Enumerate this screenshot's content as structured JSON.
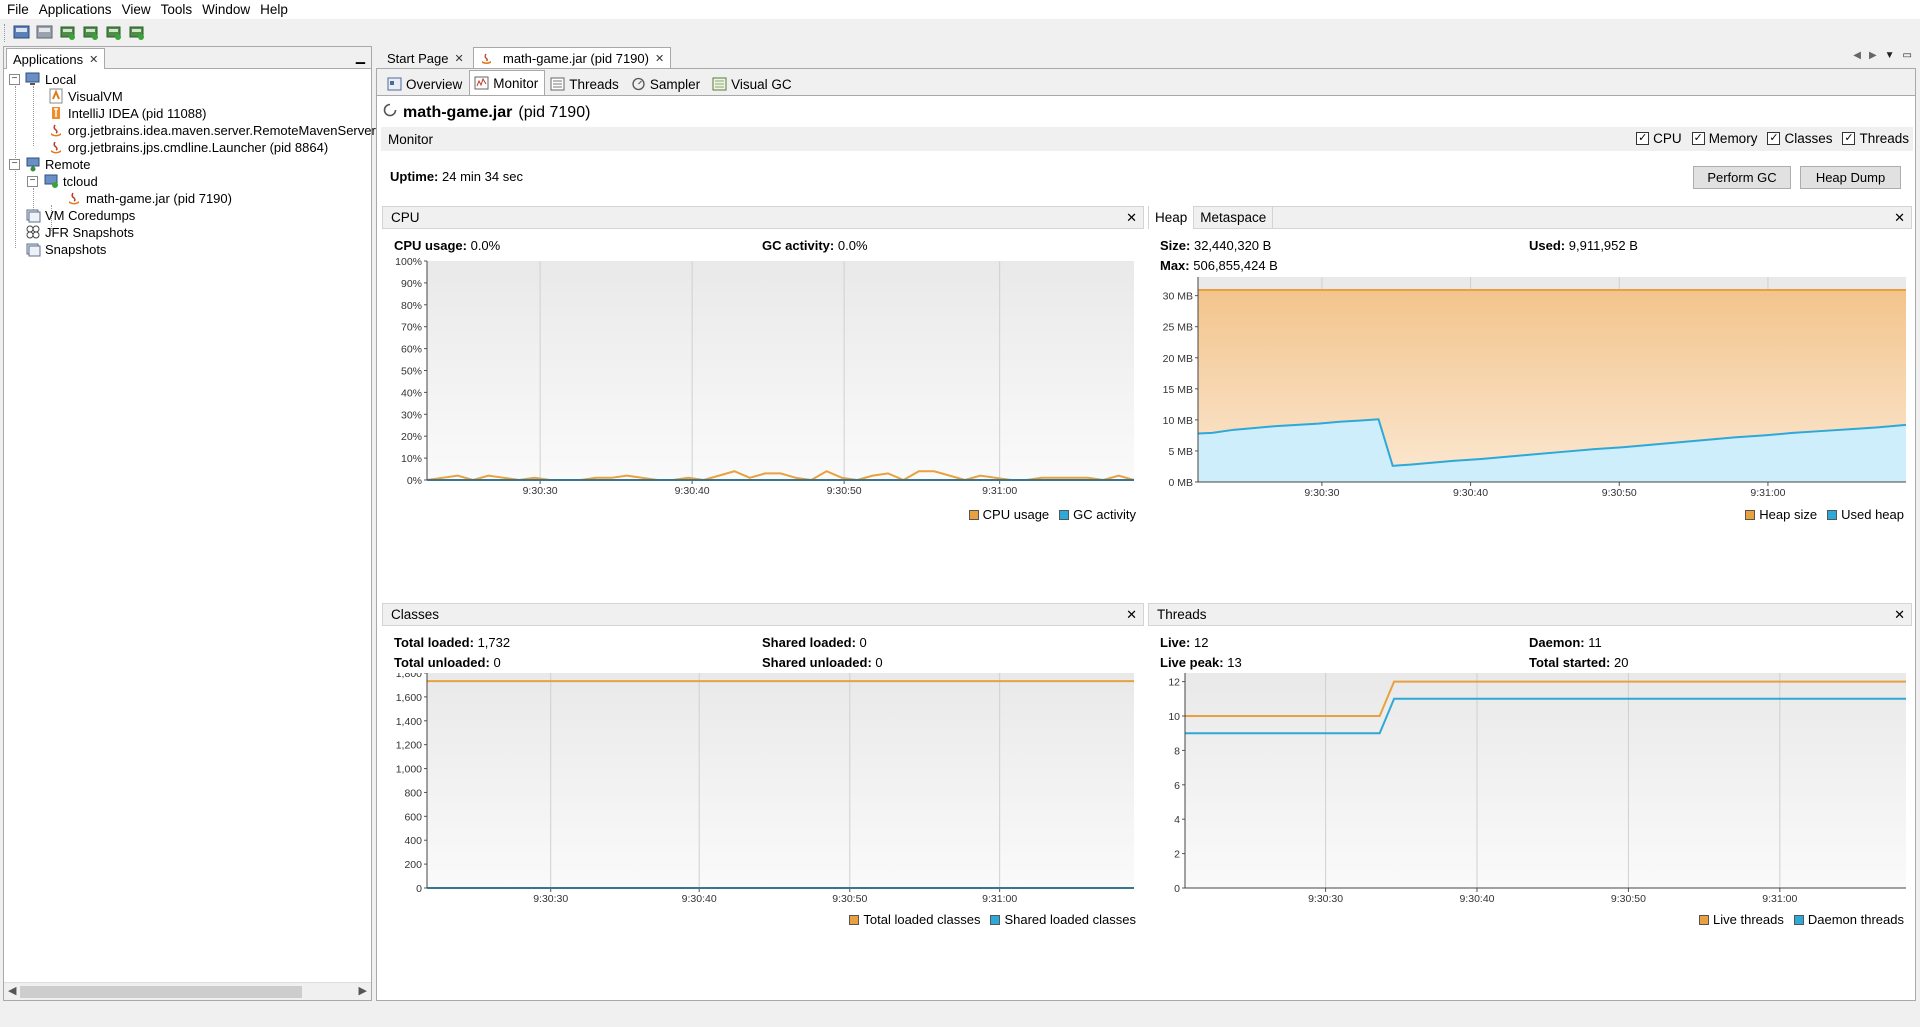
{
  "menu": [
    "File",
    "Applications",
    "View",
    "Tools",
    "Window",
    "Help"
  ],
  "toolbar_icons": [
    "load-application-dump-icon",
    "load-snapshot-icon",
    "add-remote-host-icon",
    "add-jmx-connection-icon",
    "add-coredump-icon",
    "add-heap-dump-icon"
  ],
  "left_panel": {
    "tab_label": "Applications",
    "tree": [
      {
        "label": "Local",
        "icon": "computer-icon",
        "level": 0,
        "toggle": "-"
      },
      {
        "label": "VisualVM",
        "icon": "visualvm-icon",
        "level": 1
      },
      {
        "label": "IntelliJ IDEA (pid 11088)",
        "icon": "intellij-icon",
        "level": 1
      },
      {
        "label": "org.jetbrains.idea.maven.server.RemoteMavenServer",
        "icon": "java-icon",
        "level": 1
      },
      {
        "label": "org.jetbrains.jps.cmdline.Launcher (pid 8864)",
        "icon": "java-icon",
        "level": 1
      },
      {
        "label": "Remote",
        "icon": "network-icon",
        "level": 0,
        "toggle": "-"
      },
      {
        "label": "tcloud",
        "icon": "host-icon",
        "level": 1,
        "toggle": "-"
      },
      {
        "label": "math-game.jar (pid 7190)",
        "icon": "java-icon",
        "level": 2
      },
      {
        "label": "VM Coredumps",
        "icon": "coredumps-icon",
        "level": 0
      },
      {
        "label": "JFR Snapshots",
        "icon": "jfr-icon",
        "level": 0
      },
      {
        "label": "Snapshots",
        "icon": "snapshots-icon",
        "level": 0
      }
    ]
  },
  "doc_tabs": [
    {
      "label": "Start Page",
      "active": false
    },
    {
      "label": "math-game.jar (pid 7190)",
      "active": true
    }
  ],
  "view_tabs": [
    {
      "label": "Overview",
      "icon": "overview-icon"
    },
    {
      "label": "Monitor",
      "icon": "monitor-icon",
      "active": true
    },
    {
      "label": "Threads",
      "icon": "threads-icon"
    },
    {
      "label": "Sampler",
      "icon": "sampler-icon"
    },
    {
      "label": "Visual GC",
      "icon": "visual-gc-icon"
    }
  ],
  "app_title": {
    "name": "math-game.jar",
    "pid": "(pid 7190)"
  },
  "monitor": {
    "label": "Monitor",
    "checks": [
      {
        "label": "CPU",
        "checked": true
      },
      {
        "label": "Memory",
        "checked": true
      },
      {
        "label": "Classes",
        "checked": true
      },
      {
        "label": "Threads",
        "checked": true
      }
    ],
    "uptime_label": "Uptime:",
    "uptime_value": "24 min 34 sec",
    "perform_gc": "Perform GC",
    "heap_dump": "Heap Dump"
  },
  "colors": {
    "orange": "#e8a13e",
    "blue": "#2ea8d8",
    "heap_fill_top": "#f3c48c",
    "heap_fill_bottom": "#fbe8d2",
    "used_fill": "#cdeefa",
    "plot_bg_top": "#e9e9e9",
    "plot_bg_bottom": "#fafafa"
  },
  "cpu_panel": {
    "title": "CPU",
    "cpu_usage_label": "CPU usage:",
    "cpu_usage_value": "0.0%",
    "gc_label": "GC activity:",
    "gc_value": "0.0%",
    "legend": [
      "CPU usage",
      "GC activity"
    ]
  },
  "heap_panel": {
    "tabs": [
      "Heap",
      "Metaspace"
    ],
    "size_label": "Size:",
    "size_value": "32,440,320 B",
    "used_label": "Used:",
    "used_value": "9,911,952 B",
    "max_label": "Max:",
    "max_value": "506,855,424 B",
    "legend": [
      "Heap size",
      "Used heap"
    ]
  },
  "classes_panel": {
    "title": "Classes",
    "total_loaded_label": "Total loaded:",
    "total_loaded_value": "1,732",
    "shared_loaded_label": "Shared loaded:",
    "shared_loaded_value": "0",
    "total_unloaded_label": "Total unloaded:",
    "total_unloaded_value": "0",
    "shared_unloaded_label": "Shared unloaded:",
    "shared_unloaded_value": "0",
    "legend": [
      "Total loaded classes",
      "Shared loaded classes"
    ]
  },
  "threads_panel": {
    "title": "Threads",
    "live_label": "Live:",
    "live_value": "12",
    "daemon_label": "Daemon:",
    "daemon_value": "11",
    "peak_label": "Live peak:",
    "peak_value": "13",
    "started_label": "Total started:",
    "started_value": "20",
    "legend": [
      "Live threads",
      "Daemon threads"
    ]
  },
  "chart_data": [
    {
      "id": "cpu",
      "type": "line",
      "ylim": [
        0,
        100
      ],
      "y_ticks": [
        "0%",
        "10%",
        "20%",
        "30%",
        "40%",
        "50%",
        "60%",
        "70%",
        "80%",
        "90%",
        "100%"
      ],
      "x_ticks": [
        "9:30:30",
        "9:30:40",
        "9:30:50",
        "9:31:00"
      ],
      "x_tick_pos": [
        0.16,
        0.375,
        0.59,
        0.81
      ],
      "grid": true,
      "series": [
        {
          "name": "CPU usage",
          "color": "#e8a13e",
          "values": [
            0,
            1,
            2,
            0,
            2,
            1,
            0,
            1,
            0,
            0,
            0,
            1,
            1,
            2,
            1,
            0,
            0,
            1,
            0,
            2,
            4,
            1,
            3,
            3,
            1,
            0,
            4,
            1,
            0,
            2,
            3,
            0,
            4,
            4,
            2,
            0,
            2,
            1,
            0,
            0,
            1,
            1,
            1,
            1,
            0,
            2,
            0
          ]
        },
        {
          "name": "GC activity",
          "color": "#2ea8d8",
          "values": [
            0,
            0,
            0,
            0,
            0,
            0,
            0,
            0,
            0,
            0,
            0,
            0,
            0,
            0,
            0,
            0,
            0,
            0,
            0,
            0,
            0,
            0,
            0,
            0,
            0,
            0,
            0,
            0,
            0,
            0,
            0,
            0,
            0,
            0,
            0,
            0,
            0,
            0,
            0,
            0,
            0,
            0,
            0,
            0,
            0,
            0,
            0
          ]
        }
      ]
    },
    {
      "id": "heap",
      "type": "area",
      "ylim": [
        0,
        33
      ],
      "y_ticks": [
        "0 MB",
        "5 MB",
        "10 MB",
        "15 MB",
        "20 MB",
        "25 MB",
        "30 MB"
      ],
      "x_ticks": [
        "9:30:30",
        "9:30:40",
        "9:30:50",
        "9:31:00"
      ],
      "x_tick_pos": [
        0.175,
        0.385,
        0.595,
        0.805
      ],
      "grid": true,
      "series": [
        {
          "name": "Heap size",
          "color": "#e8a13e",
          "points": [
            [
              0,
              30.9
            ],
            [
              1,
              30.9
            ]
          ]
        },
        {
          "name": "Used heap",
          "color": "#2ea8d8",
          "points": [
            [
              0,
              7.8
            ],
            [
              0.02,
              7.9
            ],
            [
              0.05,
              8.4
            ],
            [
              0.08,
              8.7
            ],
            [
              0.11,
              9.0
            ],
            [
              0.14,
              9.2
            ],
            [
              0.17,
              9.4
            ],
            [
              0.2,
              9.7
            ],
            [
              0.23,
              9.9
            ],
            [
              0.255,
              10.1
            ],
            [
              0.275,
              2.6
            ],
            [
              0.3,
              2.8
            ],
            [
              0.33,
              3.1
            ],
            [
              0.36,
              3.4
            ],
            [
              0.4,
              3.7
            ],
            [
              0.44,
              4.1
            ],
            [
              0.48,
              4.5
            ],
            [
              0.52,
              4.9
            ],
            [
              0.56,
              5.3
            ],
            [
              0.6,
              5.6
            ],
            [
              0.64,
              6.0
            ],
            [
              0.68,
              6.4
            ],
            [
              0.72,
              6.8
            ],
            [
              0.76,
              7.2
            ],
            [
              0.8,
              7.5
            ],
            [
              0.84,
              7.9
            ],
            [
              0.88,
              8.2
            ],
            [
              0.92,
              8.5
            ],
            [
              0.96,
              8.8
            ],
            [
              1,
              9.2
            ]
          ]
        }
      ]
    },
    {
      "id": "classes",
      "type": "line",
      "ylim": [
        0,
        1800
      ],
      "y_ticks": [
        "0",
        "200",
        "400",
        "600",
        "800",
        "1,000",
        "1,200",
        "1,400",
        "1,600",
        "1,800"
      ],
      "x_ticks": [
        "9:30:30",
        "9:30:40",
        "9:30:50",
        "9:31:00"
      ],
      "x_tick_pos": [
        0.175,
        0.385,
        0.598,
        0.81
      ],
      "grid": true,
      "series": [
        {
          "name": "Total loaded classes",
          "color": "#e8a13e",
          "points": [
            [
              0,
              1732
            ],
            [
              1,
              1732
            ]
          ]
        },
        {
          "name": "Shared loaded classes",
          "color": "#2ea8d8",
          "points": [
            [
              0,
              0
            ],
            [
              1,
              0
            ]
          ]
        }
      ]
    },
    {
      "id": "threads",
      "type": "line",
      "ylim": [
        0,
        12.5
      ],
      "y_ticks": [
        "0",
        "2",
        "4",
        "6",
        "8",
        "10",
        "12"
      ],
      "x_ticks": [
        "9:30:30",
        "9:30:40",
        "9:30:50",
        "9:31:00"
      ],
      "x_tick_pos": [
        0.195,
        0.405,
        0.615,
        0.825
      ],
      "grid": true,
      "series": [
        {
          "name": "Live threads",
          "color": "#e8a13e",
          "points": [
            [
              0,
              10
            ],
            [
              0.27,
              10
            ],
            [
              0.29,
              12
            ],
            [
              1,
              12
            ]
          ]
        },
        {
          "name": "Daemon threads",
          "color": "#2ea8d8",
          "points": [
            [
              0,
              9
            ],
            [
              0.27,
              9
            ],
            [
              0.29,
              11
            ],
            [
              1,
              11
            ]
          ]
        }
      ]
    }
  ]
}
